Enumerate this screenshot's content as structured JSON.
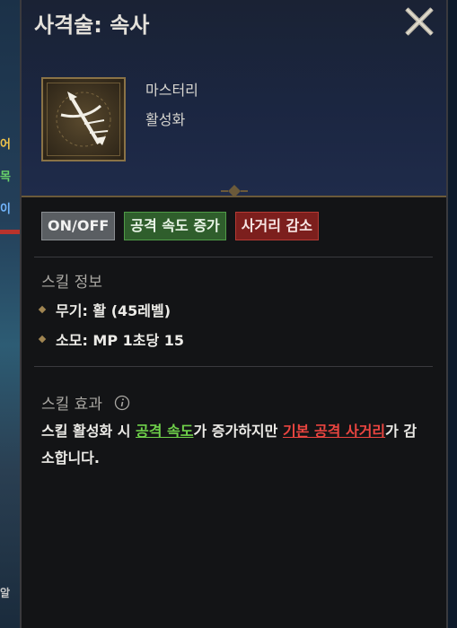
{
  "background": {
    "fragments": [
      "어",
      "목",
      "이",
      "알"
    ]
  },
  "header": {
    "title": "사격술: 속사",
    "close_icon": "close-x-icon"
  },
  "skill": {
    "icon": "bow-arrow-skill-icon",
    "type": "마스터리",
    "state": "활성화"
  },
  "tags": [
    {
      "label": "ON/OFF",
      "color": "#5a5e62"
    },
    {
      "label": "공격 속도 증가",
      "color": "#2f5e2c"
    },
    {
      "label": "사거리 감소",
      "color": "#7c1f1d"
    }
  ],
  "info": {
    "label": "스킬 정보",
    "weapon": "무기: 활 (45레벨)",
    "cost": "소모: MP 1초당 15"
  },
  "effect": {
    "label": "스킬 효과",
    "info_icon": "info-circle-icon",
    "text_1": "스킬 활성화 시 ",
    "hl_1": "공격 속도",
    "text_2": "가 증가하지만 ",
    "hl_2": "기본 공격 사거리",
    "text_3": "가 감소합니다."
  },
  "colors": {
    "highlight_green": "#6fd04a",
    "highlight_red": "#ea4540",
    "accent_gold": "#8a7346"
  }
}
